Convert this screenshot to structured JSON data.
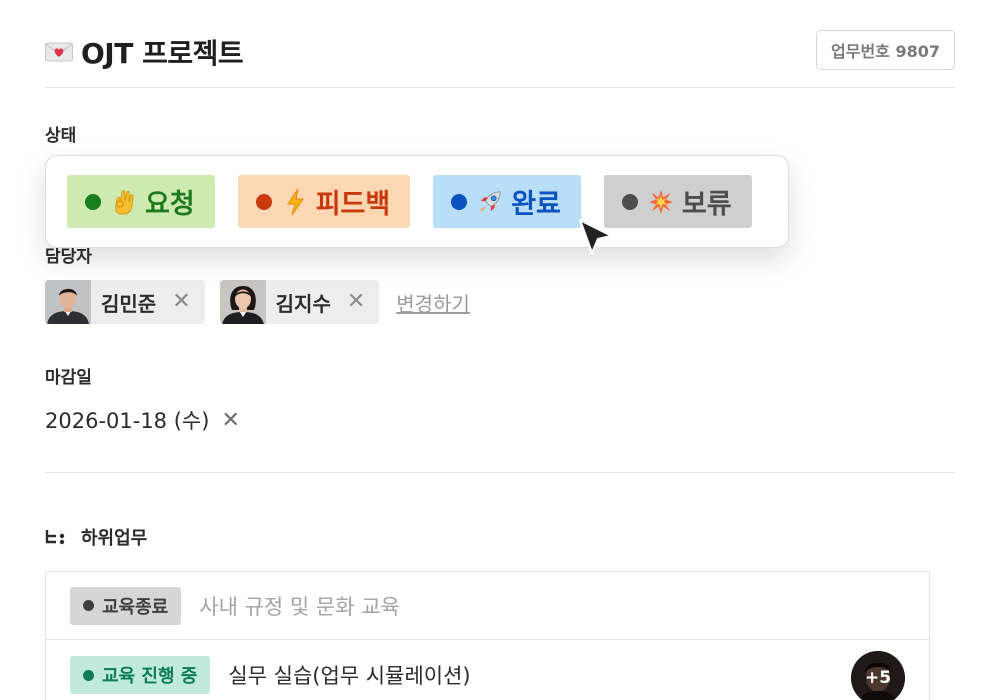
{
  "header": {
    "emoji": "envelope-heart-icon",
    "title": "OJT 프로젝트",
    "task_number": "업무번호 9807"
  },
  "status": {
    "label": "상태",
    "options": [
      {
        "label": "요청",
        "icon": "ok-hand-icon",
        "color": "#1e7a1e",
        "bg": "#cfeab0"
      },
      {
        "label": "피드백",
        "icon": "lightning-icon",
        "color": "#c83a0b",
        "bg": "#fcd7b4"
      },
      {
        "label": "완료",
        "icon": "rocket-icon",
        "color": "#0b52c0",
        "bg": "#b8def8"
      },
      {
        "label": "보류",
        "icon": "collision-icon",
        "color": "#4d4d4d",
        "bg": "#cfcfcf"
      }
    ]
  },
  "assignee": {
    "label": "담당자",
    "people": [
      {
        "name": "김민준"
      },
      {
        "name": "김지수"
      }
    ],
    "remove_symbol": "✕",
    "change_link": "변경하기"
  },
  "due": {
    "label": "마감일",
    "value": "2026-01-18 (수)",
    "clear_symbol": "✕"
  },
  "subtasks": {
    "title": "하위업무",
    "items": [
      {
        "tag": "교육종료",
        "text": "사내 규정 및 문화 교육"
      },
      {
        "tag": "교육 진행 중",
        "text": "실무 실습(업무 시뮬레이션)",
        "extra_assignees": "+5"
      }
    ]
  }
}
